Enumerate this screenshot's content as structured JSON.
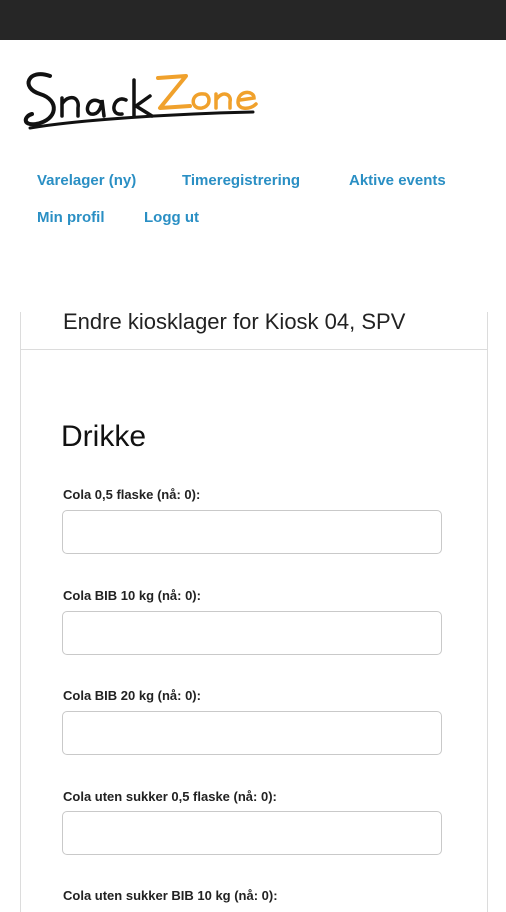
{
  "brand": {
    "logo_text_part1": "Snack",
    "logo_text_part2": "Zone",
    "primary_color": "#111111",
    "accent_color": "#f0a12c"
  },
  "nav": {
    "items": [
      {
        "label": "Varelager (ny)"
      },
      {
        "label": "Timeregistrering"
      },
      {
        "label": "Aktive events"
      },
      {
        "label": "Min profil"
      },
      {
        "label": "Logg ut"
      }
    ],
    "link_color": "#2a8fc4"
  },
  "card": {
    "title": "Endre kiosklager for Kiosk 04, SPV",
    "section_heading": "Drikke",
    "fields": [
      {
        "label": "Cola 0,5 flaske (nå: 0):",
        "value": "",
        "placeholder": ""
      },
      {
        "label": "Cola BIB 10 kg (nå: 0):",
        "value": "",
        "placeholder": ""
      },
      {
        "label": "Cola BIB 20 kg (nå: 0):",
        "value": "",
        "placeholder": ""
      },
      {
        "label": "Cola uten sukker 0,5 flaske (nå: 0):",
        "value": "",
        "placeholder": ""
      },
      {
        "label": "Cola uten sukker BIB 10 kg (nå: 0):",
        "value": "",
        "placeholder": ""
      }
    ]
  }
}
